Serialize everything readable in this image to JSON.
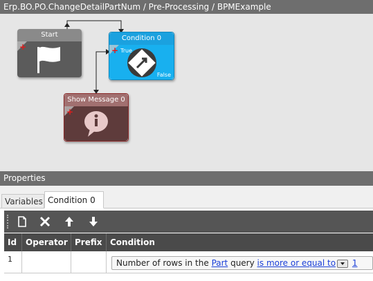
{
  "window": {
    "title": "Erp.BO.PO.ChangeDetailPartNum / Pre-Processing / BPMExample"
  },
  "workflow": {
    "nodes": {
      "start": {
        "label": "Start",
        "icon": "flag-icon"
      },
      "condition": {
        "label": "Condition 0",
        "true_label": "True",
        "false_label": "False",
        "icon": "diamond-arrow-icon"
      },
      "show_message": {
        "label": "Show Message 0",
        "icon": "info-bubble-icon"
      }
    },
    "add_icon": "+"
  },
  "properties": {
    "title": "Properties",
    "tabs": [
      {
        "label": "Variables",
        "active": false
      },
      {
        "label": "Condition 0",
        "active": true
      }
    ],
    "toolbar": {
      "buttons": [
        "new-icon",
        "delete-icon",
        "move-up-icon",
        "move-down-icon"
      ]
    },
    "grid": {
      "columns": [
        "Id",
        "Operator",
        "Prefix",
        "Condition"
      ],
      "rows": [
        {
          "id": "1",
          "operator": "",
          "prefix": "",
          "condition": {
            "text_before": "Number of rows in the ",
            "link_part": "Part",
            "text_middle": " query ",
            "link_operator": "is more or equal to",
            "link_value": "1"
          }
        }
      ]
    }
  },
  "colors": {
    "condition_accent": "#18b0ef",
    "start_body": "#5b5b5b",
    "show_message_body": "#5e3b3b",
    "link": "#1a3fd8"
  }
}
